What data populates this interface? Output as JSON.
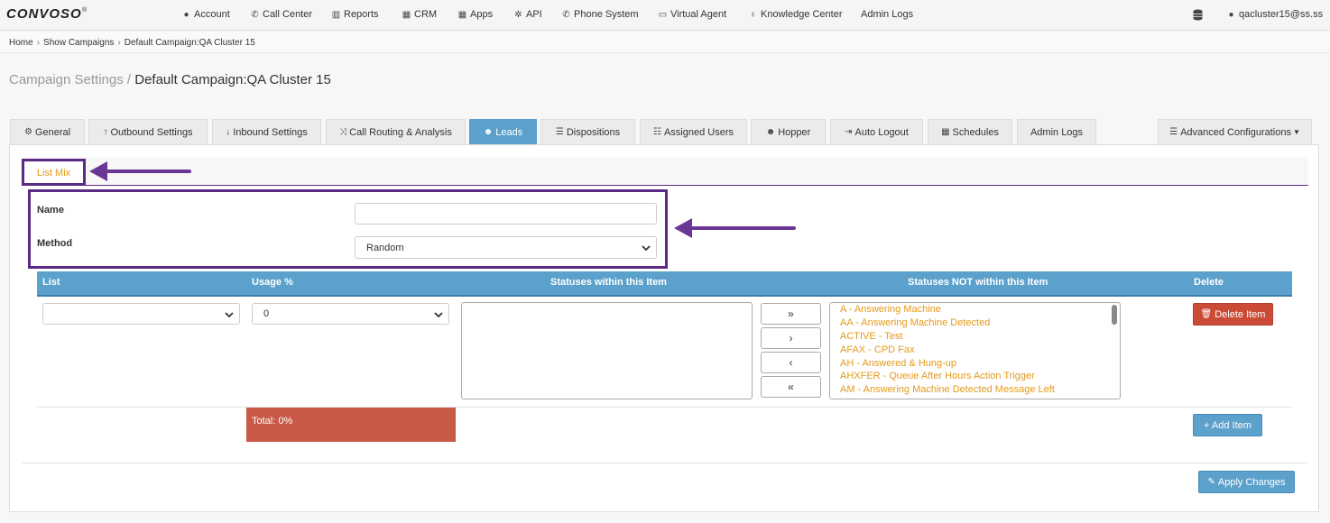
{
  "app": {
    "logo_text": "CONVOSO",
    "logo_mark": "®"
  },
  "nav": {
    "items": [
      {
        "label": "Account",
        "icon": "user-icon",
        "glyph": "●"
      },
      {
        "label": "Call Center",
        "icon": "phone-icon",
        "glyph": "✆"
      },
      {
        "label": "Reports",
        "icon": "bar-chart-icon",
        "glyph": "▥"
      },
      {
        "label": "CRM",
        "icon": "table-icon",
        "glyph": "▦"
      },
      {
        "label": "Apps",
        "icon": "grid-icon",
        "glyph": "▦"
      },
      {
        "label": "API",
        "icon": "gear-icon",
        "glyph": "✲"
      },
      {
        "label": "Phone System",
        "icon": "phone-icon",
        "glyph": "✆"
      },
      {
        "label": "Virtual Agent",
        "icon": "desktop-icon",
        "glyph": "▭"
      },
      {
        "label": "Knowledge Center",
        "icon": "lightbulb-icon",
        "glyph": "♁"
      },
      {
        "label": "Admin Logs",
        "icon": "",
        "glyph": ""
      }
    ],
    "user_email": "qacluster15@ss.ss"
  },
  "breadcrumb": [
    "Home",
    "Show Campaigns",
    "Default Campaign:QA Cluster 15"
  ],
  "page_title": {
    "section": "Campaign Settings /",
    "campaign": "Default Campaign:QA Cluster 15"
  },
  "tabs": [
    {
      "label": "General",
      "glyph": "⚙"
    },
    {
      "label": "Outbound Settings",
      "glyph": "↑"
    },
    {
      "label": "Inbound Settings",
      "glyph": "↓"
    },
    {
      "label": "Call Routing & Analysis",
      "glyph": "⤨"
    },
    {
      "label": "Leads",
      "glyph": "☻"
    },
    {
      "label": "Dispositions",
      "glyph": "☰"
    },
    {
      "label": "Assigned Users",
      "glyph": "☷"
    },
    {
      "label": "Hopper",
      "glyph": "☻"
    },
    {
      "label": "Auto Logout",
      "glyph": "⇥"
    },
    {
      "label": "Schedules",
      "glyph": "▦"
    },
    {
      "label": "Admin Logs",
      "glyph": ""
    },
    {
      "label": "Advanced Configurations",
      "glyph": "☰"
    }
  ],
  "active_tab": "Leads",
  "subtab": {
    "label": "List Mix"
  },
  "form": {
    "name_label": "Name",
    "name_value": "",
    "method_label": "Method",
    "method_value": "Random"
  },
  "table": {
    "headers": {
      "list": "List",
      "usage": "Usage %",
      "within": "Statuses within this Item",
      "not_within": "Statuses NOT within this Item",
      "delete": "Delete"
    },
    "list_value": "",
    "usage_value": "0",
    "move_buttons": [
      "»",
      "›",
      "‹",
      "«"
    ],
    "statuses_not_within": [
      "A - Answering Machine",
      "AA - Answering Machine Detected",
      "ACTIVE - Test",
      "AFAX - CPD Fax",
      "AH - Answered & Hung-up",
      "AHXFER - Queue After Hours Action Trigger",
      "AM - Answering Machine Detected Message Left"
    ],
    "delete_label": "Delete Item",
    "total_label": "Total: 0%",
    "add_label": "+ Add Item"
  },
  "apply_label": "Apply Changes",
  "colors": {
    "accent": "#5ba1cb",
    "danger": "#c95a47",
    "highlight": "#5b2a84",
    "status_text": "#e49a1a"
  }
}
